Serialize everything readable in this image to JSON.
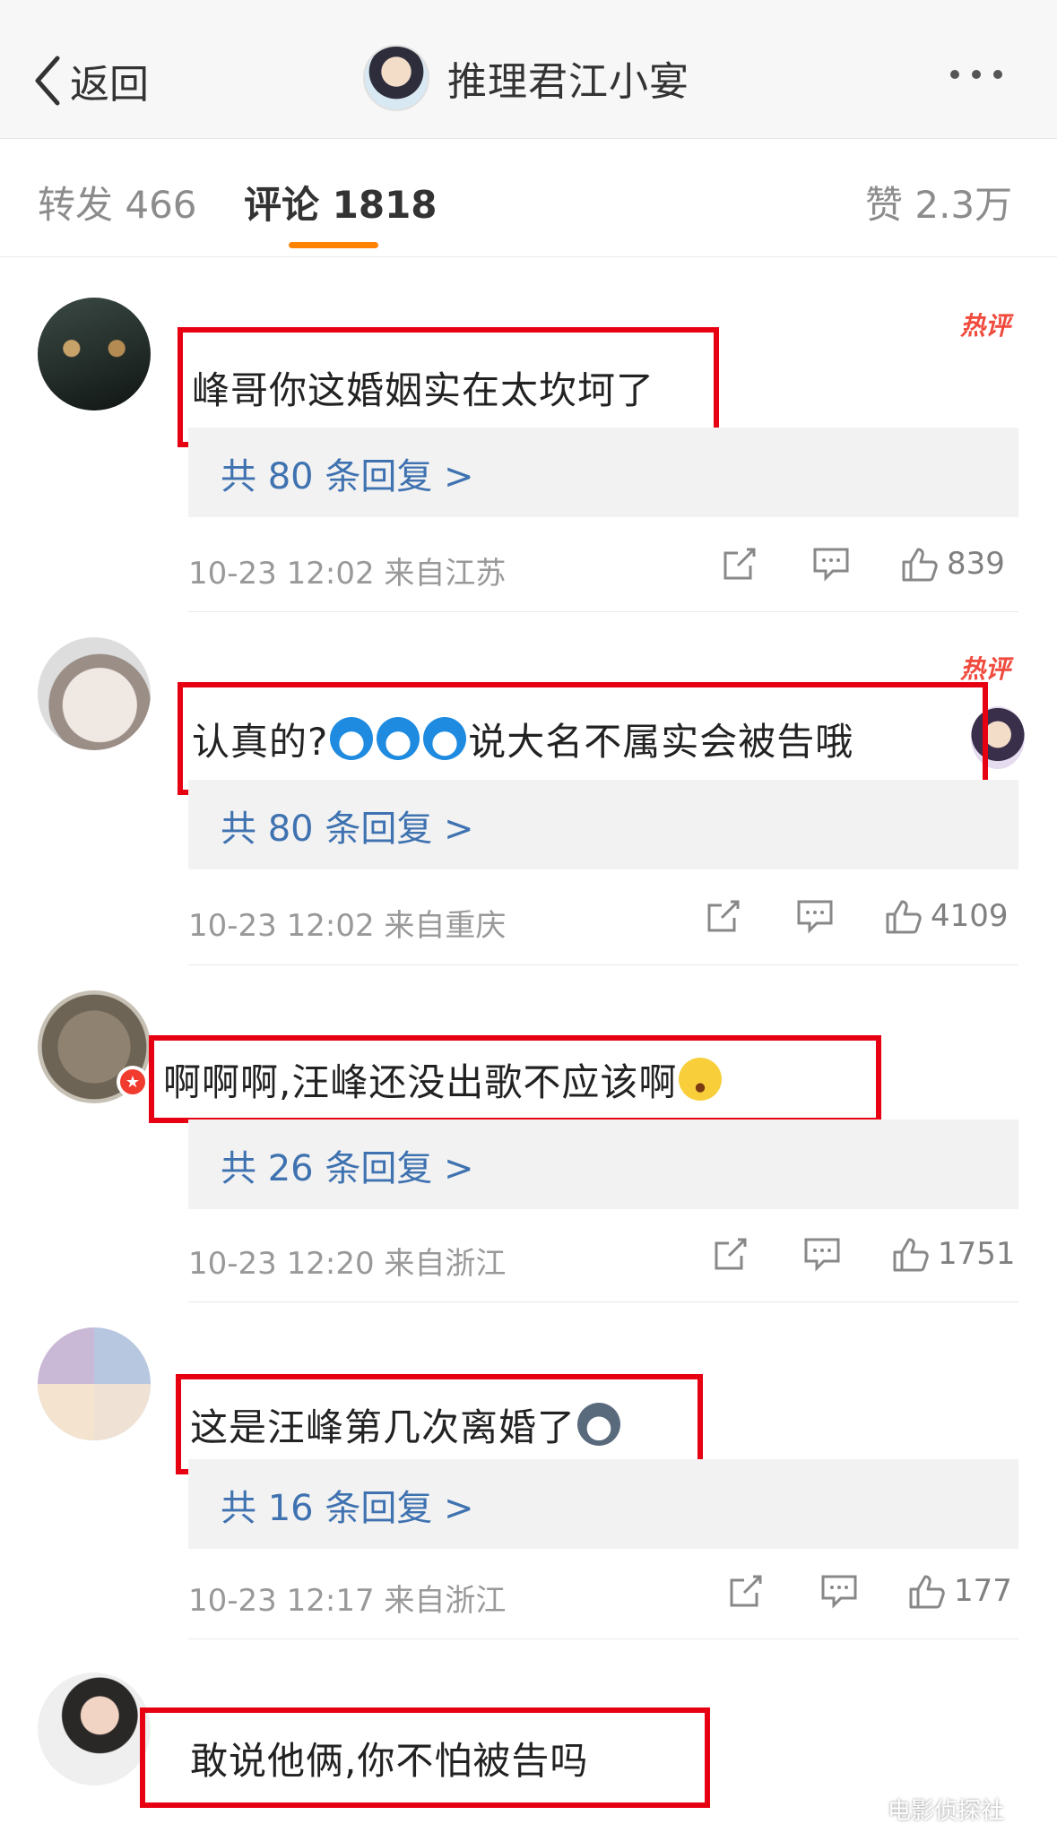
{
  "header": {
    "back_label": "返回",
    "title": "推理君江小宴",
    "more_icon": "more-icon"
  },
  "tabs": [
    {
      "label": "转发 466",
      "active": false
    },
    {
      "label": "评论 1818",
      "active": true
    },
    {
      "label": "赞 2.3万",
      "active": false
    }
  ],
  "colors": {
    "accent": "#ff8200",
    "highlight_box": "#e60012",
    "reply_link": "#3f72b0",
    "hot_badge": "#f04b3e"
  },
  "comments": [
    {
      "hot_label": "热评",
      "text": "峰哥你这婚姻实在太坎坷了",
      "emojis": [],
      "text_after": "",
      "replies": "共 80 条回复 >",
      "meta": "10-23 12:02  来自江苏",
      "likes": "839"
    },
    {
      "hot_label": "热评",
      "text": "认真的?",
      "emojis": [
        "doraemon-emoji",
        "doraemon-emoji",
        "doraemon-emoji"
      ],
      "text_after": "说大名不属实会被告哦",
      "replies": "共 80 条回复 >",
      "meta": "10-23 12:02  来自重庆",
      "likes": "4109"
    },
    {
      "hot_label": "",
      "text": "啊啊啊,汪峰还没出歌不应该啊",
      "emojis": [
        "shocked-emoji"
      ],
      "text_after": "",
      "replies": "共 26 条回复 >",
      "meta": "10-23 12:20  来自浙江",
      "likes": "1751"
    },
    {
      "hot_label": "",
      "text": "这是汪峰第几次离婚了",
      "emojis": [
        "husky-emoji"
      ],
      "text_after": "",
      "replies": "共 16 条回复 >",
      "meta": "10-23 12:17  来自浙江",
      "likes": "177"
    },
    {
      "hot_label": "",
      "text": "敢说他俩,你不怕被告吗",
      "emojis": [],
      "text_after": "",
      "replies": "",
      "meta": "",
      "likes": ""
    }
  ],
  "watermark": "电影侦探社"
}
